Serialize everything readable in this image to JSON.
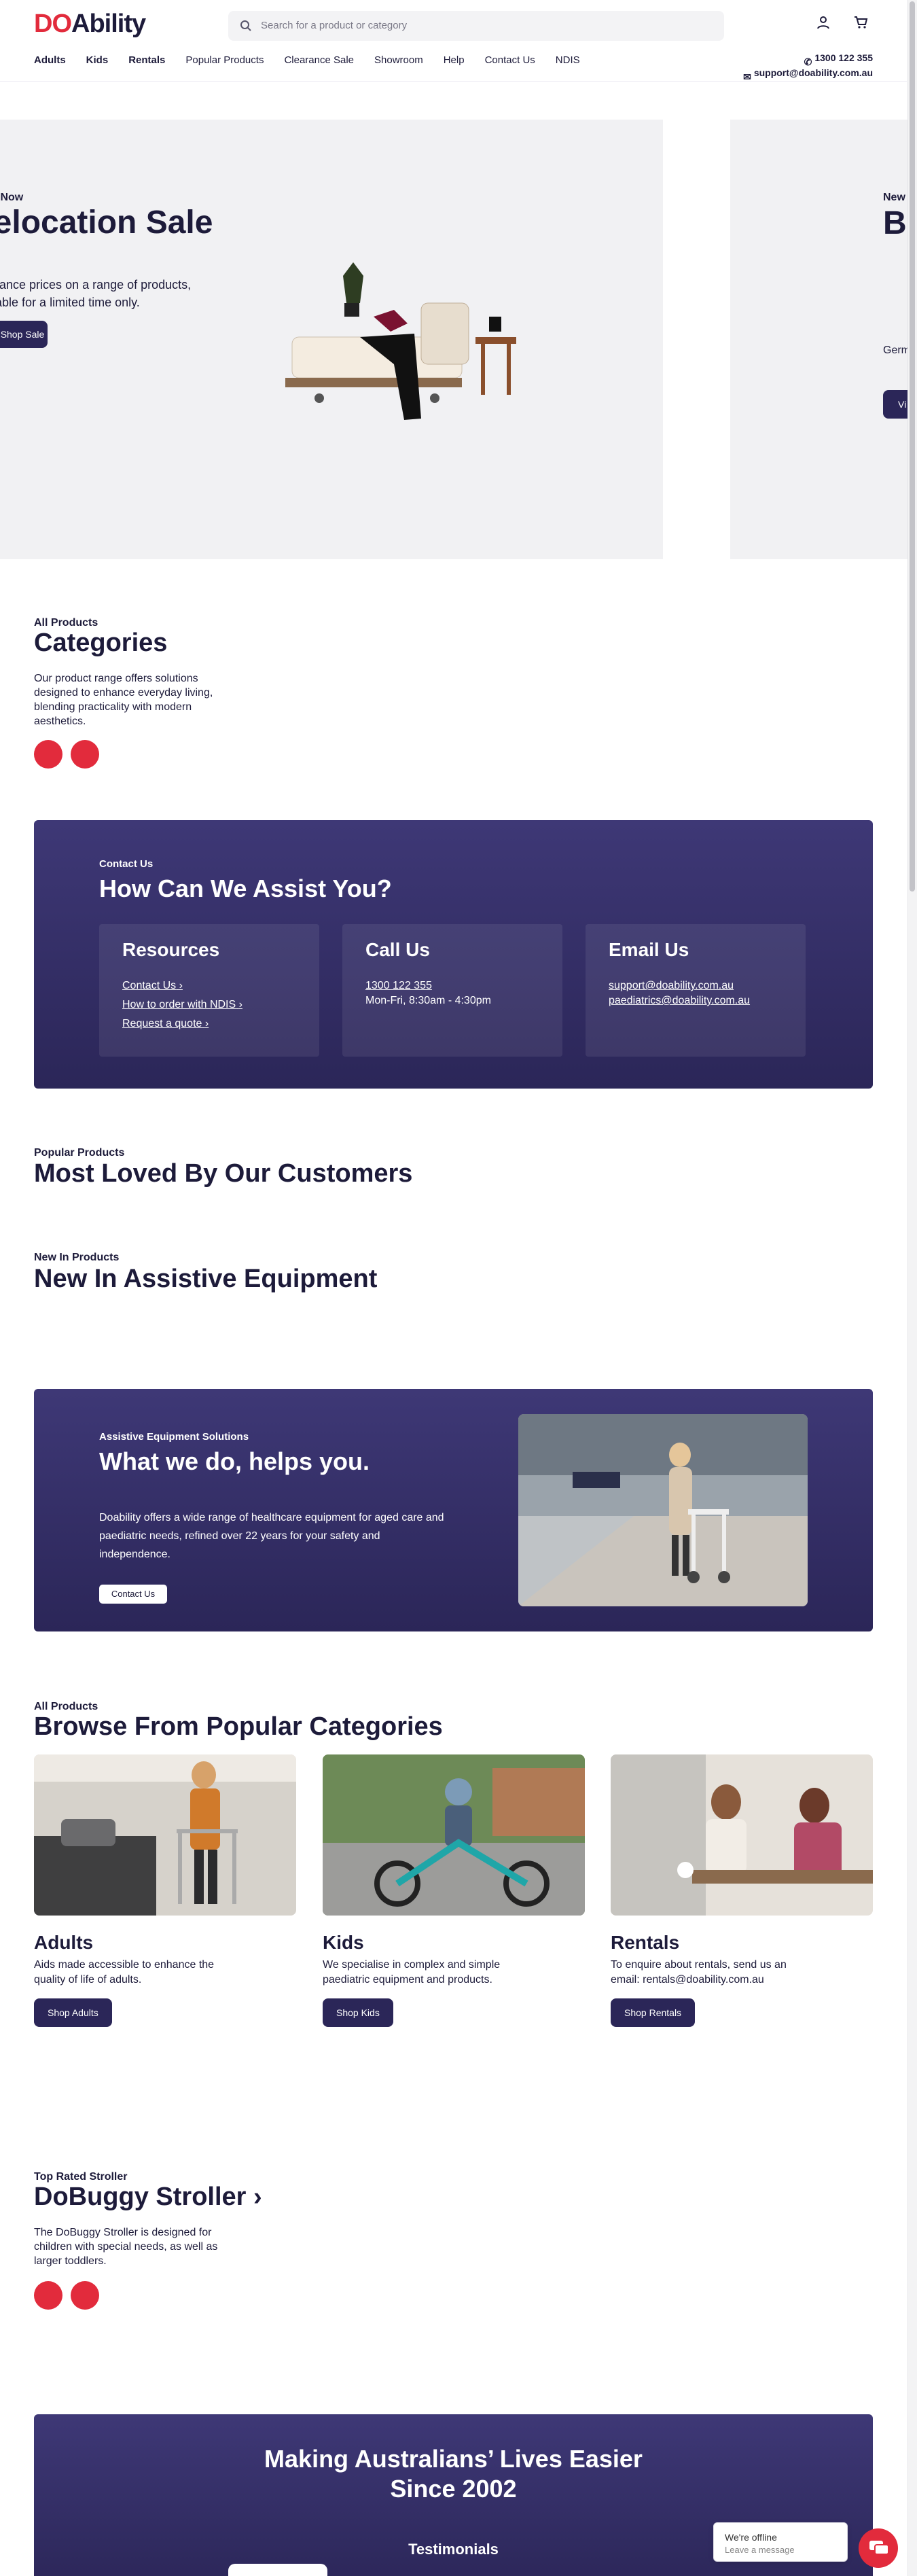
{
  "header": {
    "logo_do": "DO",
    "logo_ability": "Ability",
    "search_placeholder": "Search for a product or category",
    "nav": [
      "Adults",
      "Kids",
      "Rentals",
      "Popular Products",
      "Clearance Sale",
      "Showroom",
      "Help",
      "Contact Us",
      "NDIS"
    ],
    "phone": "1300 122 355",
    "email": "support@doability.com.au"
  },
  "hero": {
    "eyebrow": "Shop Now",
    "title": "Relocation Sale",
    "desc": "Clearance prices on a range of products, available for a limited time only.",
    "button": "Shop Sale"
  },
  "hero_next": {
    "eyebrow": "New",
    "title": "Be Pa W",
    "desc": "Germ whe",
    "button": "Vi"
  },
  "categories_intro": {
    "eyebrow": "All Products",
    "title": "Categories",
    "desc": "Our product range offers solutions designed to enhance everyday living, blending practicality with modern aesthetics."
  },
  "assist": {
    "eyebrow": "Contact Us",
    "title": "How Can We Assist You?",
    "resources": {
      "title": "Resources",
      "links": [
        "Contact Us",
        "How to order with NDIS",
        "Request a quote"
      ]
    },
    "call": {
      "title": "Call Us",
      "phone": "1300 122 355",
      "hours": "Mon-Fri, 8:30am - 4:30pm"
    },
    "email": {
      "title": "Email Us",
      "addresses": [
        "support@doability.com.au",
        "paediatrics@doability.com.au"
      ]
    }
  },
  "popular": {
    "eyebrow": "Popular Products",
    "title": "Most Loved By Our Customers"
  },
  "new_in": {
    "eyebrow": "New In Products",
    "title": "New In Assistive Equipment"
  },
  "what_we_do": {
    "eyebrow": "Assistive Equipment Solutions",
    "title": "What we do, helps you.",
    "desc": "Doability offers a wide range of healthcare equipment for aged care and paediatric needs, refined over 22 years for your safety and independence.",
    "button": "Contact Us"
  },
  "browse": {
    "eyebrow": "All Products",
    "title": "Browse From Popular Categories",
    "items": [
      {
        "name": "Adults",
        "desc": "Aids made accessible to enhance the quality of life of adults.",
        "button": "Shop Adults"
      },
      {
        "name": "Kids",
        "desc": "We specialise in complex and simple paediatric equipment and products.",
        "button": "Shop Kids"
      },
      {
        "name": "Rentals",
        "desc": "To enquire about rentals, send us an email: rentals@doability.com.au",
        "button": "Shop Rentals"
      }
    ]
  },
  "stroller": {
    "eyebrow": "Top Rated Stroller",
    "title": "DoBuggy Stroller",
    "desc": "The DoBuggy Stroller is designed for children with special needs, as well as larger toddlers."
  },
  "bottom": {
    "title_line1": "Making Australians’ Lives Easier",
    "title_line2": "Since 2002",
    "sub": "Testimonials"
  },
  "chat": {
    "status": "We're offline",
    "prompt": "Leave a message"
  },
  "colors": {
    "brand_red": "#e22b3c",
    "brand_navy": "#2b2658"
  },
  "icons": [
    "search-icon",
    "user-icon",
    "cart-icon",
    "phone-icon",
    "mail-icon",
    "chevron-right-icon",
    "chat-icon"
  ]
}
